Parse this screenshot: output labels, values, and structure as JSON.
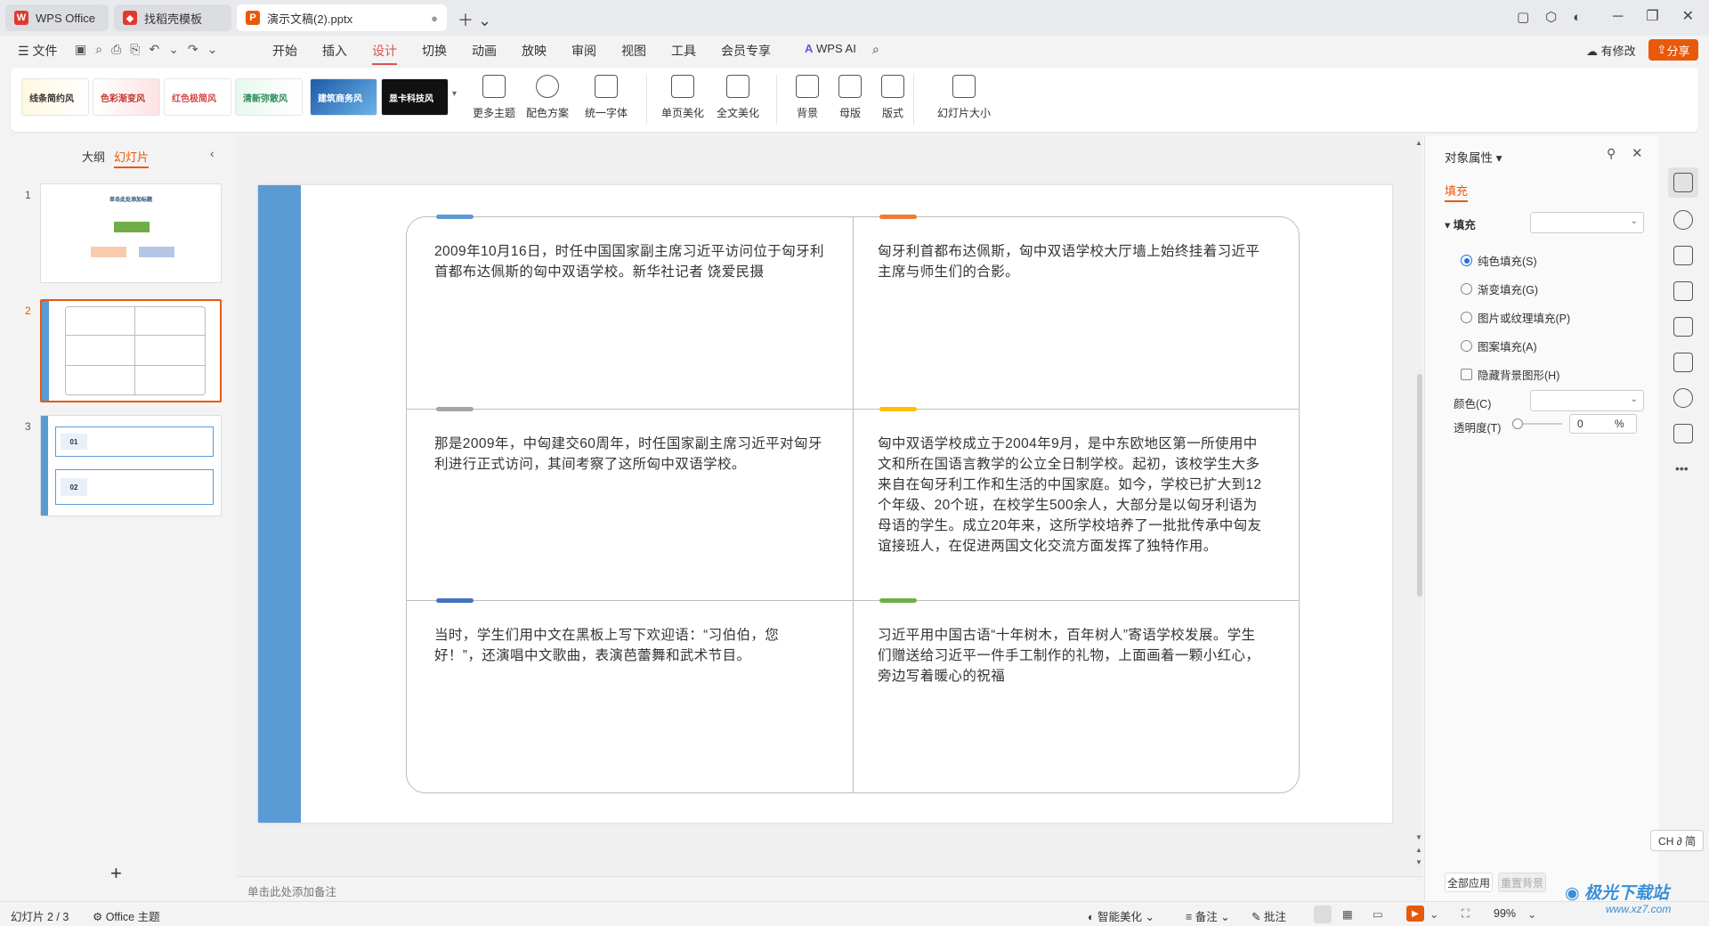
{
  "tabs": [
    {
      "label": "WPS Office"
    },
    {
      "label": "找稻壳模板"
    },
    {
      "label": "演示文稿(2).pptx"
    }
  ],
  "menu": {
    "file": "文件",
    "items": [
      "开始",
      "插入",
      "设计",
      "切换",
      "动画",
      "放映",
      "审阅",
      "视图",
      "工具",
      "会员专享"
    ],
    "active": "设计",
    "ai": "WPS AI",
    "revise": "有修改",
    "share": "分享"
  },
  "ribbon": {
    "themes": [
      "线条简约风",
      "色彩渐变风",
      "红色极简风",
      "清新弥散风",
      "建筑商务风",
      "显卡科技风"
    ],
    "buttons": [
      "更多主题",
      "配色方案",
      "统一字体",
      "单页美化",
      "全文美化",
      "背景",
      "母版",
      "版式",
      "幻灯片大小"
    ]
  },
  "panel": {
    "outline_tab": "大纲",
    "slides_tab": "幻灯片",
    "slide_numbers": [
      "1",
      "2",
      "3"
    ],
    "thumb1_title": "单击此处添加标题",
    "thumb3_items": [
      "01",
      "02"
    ]
  },
  "slide": {
    "cells": [
      "2009年10月16日，时任中国国家副主席习近平访问位于匈牙利首都布达佩斯的匈中双语学校。新华社记者 饶爱民摄",
      "匈牙利首都布达佩斯，匈中双语学校大厅墙上始终挂着习近平主席与师生们的合影。",
      "那是2009年，中匈建交60周年，时任国家副主席习近平对匈牙利进行正式访问，其间考察了这所匈中双语学校。",
      "匈中双语学校成立于2004年9月，是中东欧地区第一所使用中文和所在国语言教学的公立全日制学校。起初，该校学生大多来自在匈牙利工作和生活的中国家庭。如今，学校已扩大到12个年级、20个班，在校学生500余人，大部分是以匈牙利语为母语的学生。成立20年来，这所学校培养了一批批传承中匈友谊接班人，在促进两国文化交流方面发挥了独特作用。",
      "当时，学生们用中文在黑板上写下欢迎语：“习伯伯，您好！”，还演唱中文歌曲，表演芭蕾舞和武术节目。",
      "习近平用中国古语“十年树木，百年树人”寄语学校发展。学生们赠送给习近平一件手工制作的礼物，上面画着一颗小红心，旁边写着暖心的祝福"
    ],
    "accent_colors": [
      "#5b9bd5",
      "#ed7d31",
      "#a5a5a5",
      "#ffc000",
      "#4472c4",
      "#70ad47"
    ]
  },
  "notes_placeholder": "单击此处添加备注",
  "props": {
    "title": "对象属性",
    "fill_tab": "填充",
    "fill_section": "填充",
    "options": [
      "纯色填充(S)",
      "渐变填充(G)",
      "图片或纹理填充(P)",
      "图案填充(A)"
    ],
    "hide_bg": "隐藏背景图形(H)",
    "color_label": "颜色(C)",
    "transparency_label": "透明度(T)",
    "transparency_value": "0",
    "percent": "%",
    "apply_all": "全部应用",
    "reset_bg": "重置背景"
  },
  "ime": "CH ∂ 简",
  "status": {
    "slide_info": "幻灯片 2 / 3",
    "theme": "Office 主题",
    "smart": "智能美化",
    "notes": "备注",
    "comments": "批注",
    "zoom": "99%"
  },
  "watermark": "极光下载站",
  "watermark_url": "www.xz7.com"
}
